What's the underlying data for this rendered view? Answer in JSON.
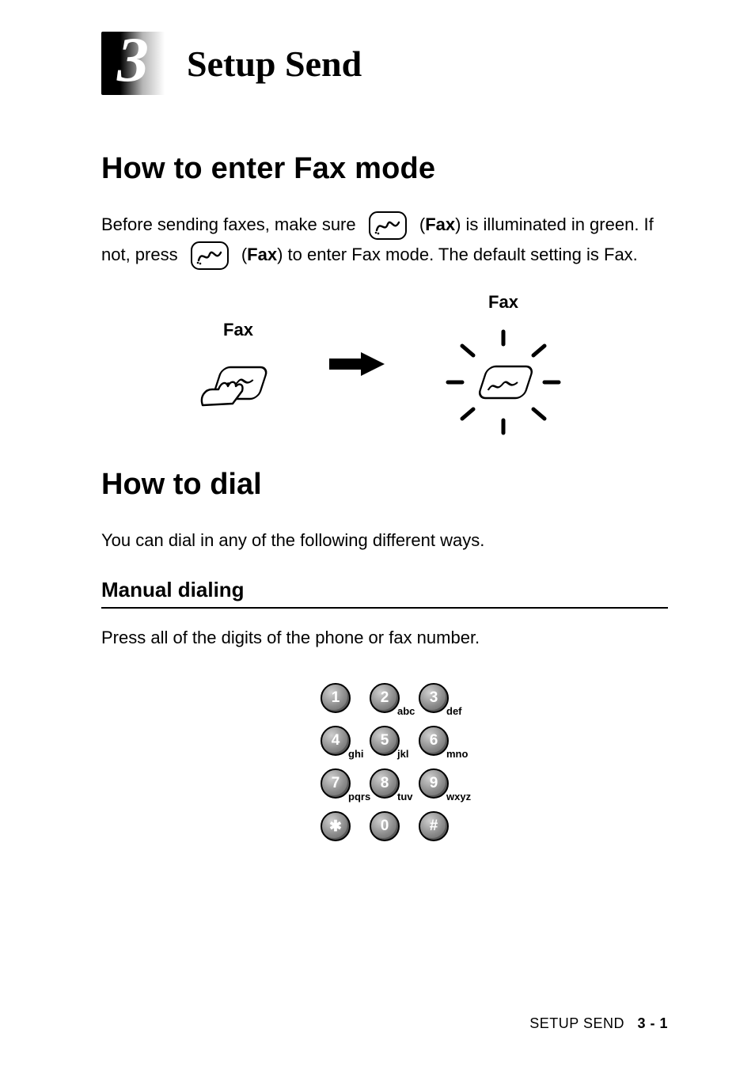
{
  "chapter": {
    "number": "3",
    "title": "Setup Send"
  },
  "s1": {
    "title": "How to enter Fax mode",
    "p1a": "Before sending faxes, make sure ",
    "p1b": "Fax",
    "p1c": ") is illuminated in green. If not, press ",
    "p1d": "Fax",
    "p1e": ") to enter Fax mode. The default setting is Fax.",
    "illu_left_label": "Fax",
    "illu_right_label": "Fax"
  },
  "s2": {
    "title": "How to dial",
    "intro": "You can dial in any of the following different ways."
  },
  "s2_1": {
    "title": "Manual dialing",
    "intro": "Press all of the digits of the phone or fax number.",
    "keypad": [
      [
        {
          "d": "1",
          "s": ""
        },
        {
          "d": "2",
          "s": "abc"
        },
        {
          "d": "3",
          "s": "def"
        }
      ],
      [
        {
          "d": "4",
          "s": "ghi"
        },
        {
          "d": "5",
          "s": "jkl"
        },
        {
          "d": "6",
          "s": "mno"
        }
      ],
      [
        {
          "d": "7",
          "s": "pqrs"
        },
        {
          "d": "8",
          "s": "tuv"
        },
        {
          "d": "9",
          "s": "wxyz"
        }
      ],
      [
        {
          "d": "✱",
          "s": ""
        },
        {
          "d": "0",
          "s": ""
        },
        {
          "d": "#",
          "s": ""
        }
      ]
    ]
  },
  "footer": {
    "section": "SETUP SEND",
    "page": "3 - 1"
  }
}
